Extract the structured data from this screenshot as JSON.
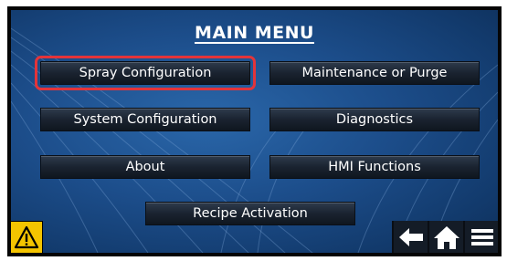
{
  "header": {
    "title": "MAIN MENU"
  },
  "menu": {
    "spray_configuration": "Spray Configuration",
    "maintenance_or_purge": "Maintenance or Purge",
    "system_configuration": "System Configuration",
    "diagnostics": "Diagnostics",
    "about": "About",
    "hmi_functions": "HMI Functions",
    "recipe_activation": "Recipe Activation"
  },
  "footer": {
    "warning_icon": "warning-triangle",
    "back_icon": "left-arrow",
    "home_icon": "home",
    "menu_icon": "hamburger"
  },
  "colors": {
    "background": "#1c4d8a",
    "button": "#1a2330",
    "highlight": "#e3343a",
    "warning": "#f4c400"
  }
}
